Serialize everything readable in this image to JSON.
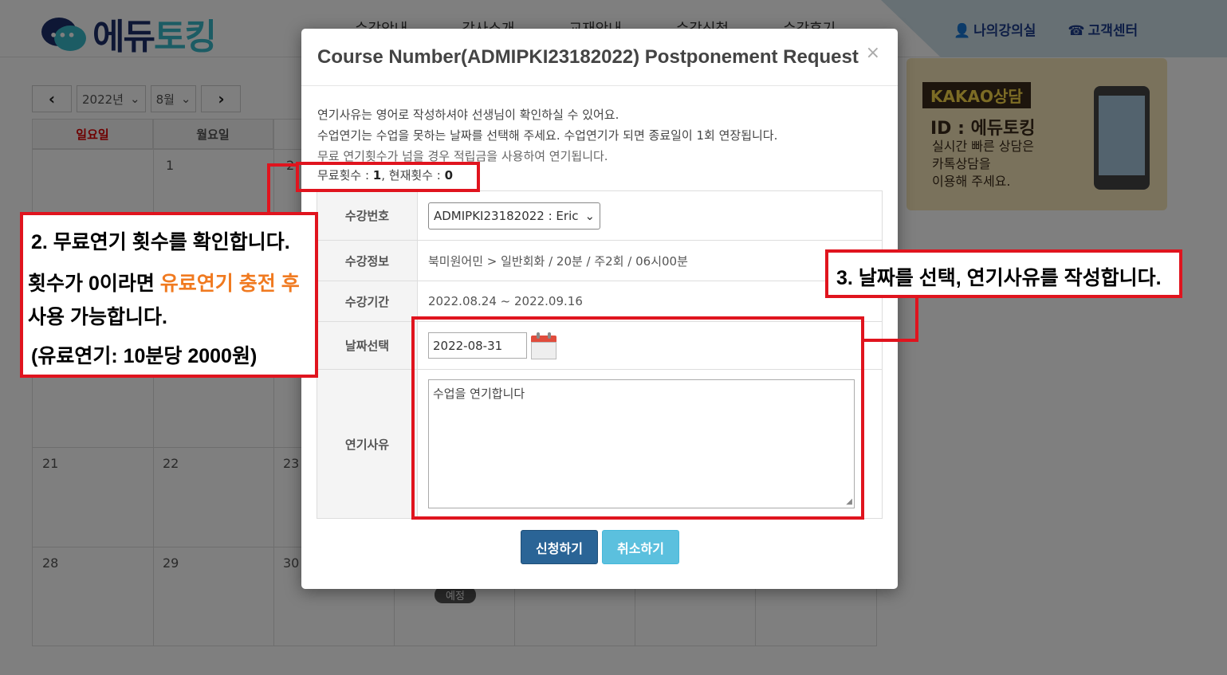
{
  "site": {
    "logo_text_a": "에듀",
    "logo_text_b": "토킹",
    "nav": [
      "수강안내",
      "강사소개",
      "교재안내",
      "수강신청",
      "수강후기"
    ],
    "my_lecture_label": "나의강의실",
    "support_label": "고객센터"
  },
  "calendar": {
    "year": "2022년",
    "month": "8월",
    "weekdays": [
      "일요일",
      "월요일"
    ],
    "days": [
      "1",
      "2",
      "21",
      "22",
      "23",
      "28",
      "29",
      "30"
    ],
    "pending_badge": "예정"
  },
  "kakao": {
    "tag": "KAKAO상담",
    "id": "ID : 에듀토킹",
    "line1": "실시간 빠른 상담은",
    "line2": "카톡상담을",
    "line3": "이용해 주세요."
  },
  "modal": {
    "title": "Course Number(ADMIPKI23182022) Postponement Request",
    "close": "×",
    "notice1": "연기사유는 영어로 작성하셔야 선생님이 확인하실 수 있어요.",
    "notice2": "수업연기는 수업을 못하는 날짜를 선택해 주세요. 수업연기가 되면 종료일이 1회 연장됩니다.",
    "notice3": "무료 연기횟수가 넘을 경우 적립금을 사용하여 연기됩니다.",
    "free_count_label": "무료횟수 : ",
    "free_count": "1",
    "current_count_label": ", 현재횟수 : ",
    "current_count": "0",
    "rows": {
      "course_no_label": "수강번호",
      "course_no_value": "ADMIPKI23182022 : Eric",
      "course_info_label": "수강정보",
      "course_info_value": "북미원어민 > 일반회화 / 20분 / 주2회 / 06시00분",
      "period_label": "수강기간",
      "period_value": "2022.08.24 ~ 2022.09.16",
      "date_label": "날짜선택",
      "date_value": "2022-08-31",
      "reason_label": "연기사유",
      "reason_value": "수업을 연기합니다"
    },
    "submit": "신청하기",
    "cancel": "취소하기"
  },
  "annotations": {
    "step2_title": "2. 무료연기 횟수를 확인합니다.",
    "step2_line1a": "횟수가 0이라면 ",
    "step2_line1b": "유료연기 충전 후",
    "step2_line2": "사용 가능합니다.",
    "step2_line3": "(유료연기: 10분당 2000원)",
    "step3_title": "3. 날짜를 선택, 연기사유를 작성합니다."
  }
}
